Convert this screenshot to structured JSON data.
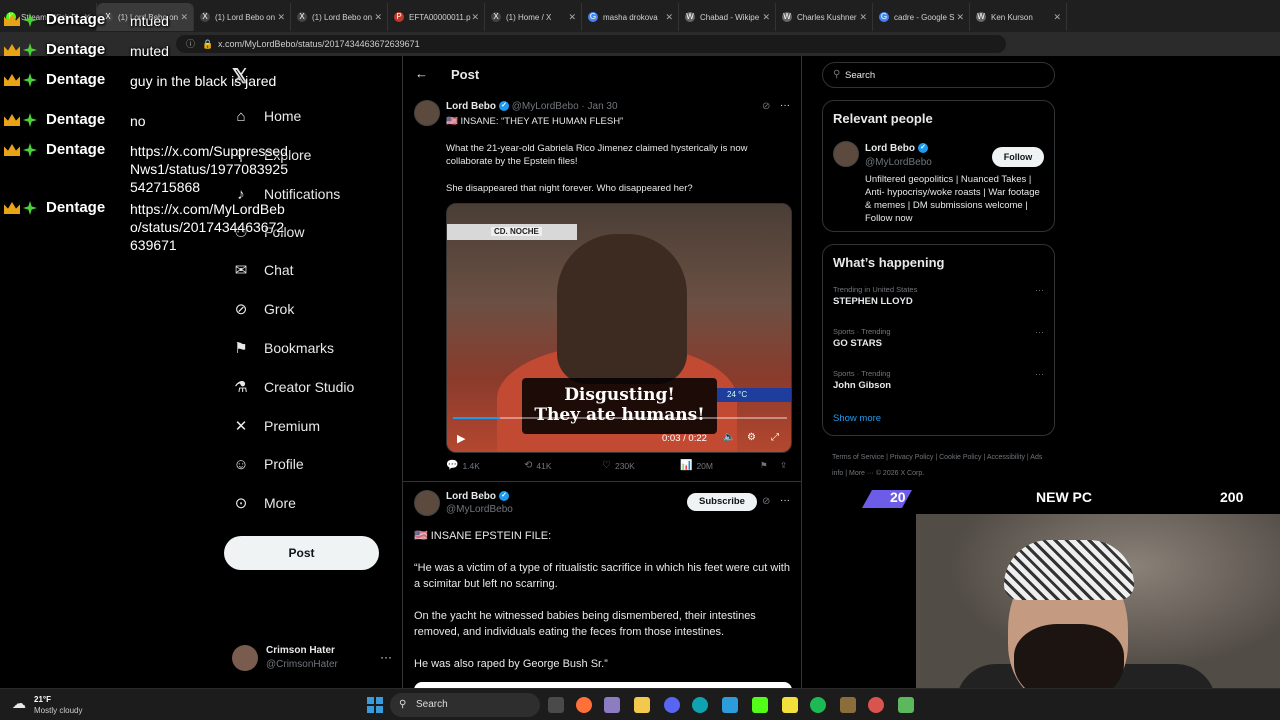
{
  "browser": {
    "tabs": [
      {
        "title": "Stream - Kick D",
        "fav": "K",
        "color": "#53fc18"
      },
      {
        "title": "(1) Lord Bebo on",
        "fav": "X",
        "color": "#444",
        "active": true
      },
      {
        "title": "(1) Lord Bebo on",
        "fav": "X",
        "color": "#444"
      },
      {
        "title": "(1) Lord Bebo on",
        "fav": "X",
        "color": "#444"
      },
      {
        "title": "EFTA00000011.p",
        "fav": "P",
        "color": "#c0392b"
      },
      {
        "title": "(1) Home / X",
        "fav": "X",
        "color": "#444"
      },
      {
        "title": "masha drokova",
        "fav": "G",
        "color": "#4285f4"
      },
      {
        "title": "Chabad - Wikipe",
        "fav": "W",
        "color": "#666"
      },
      {
        "title": "Charles Kushner",
        "fav": "W",
        "color": "#666"
      },
      {
        "title": "cadre - Google S",
        "fav": "G",
        "color": "#4285f4"
      },
      {
        "title": "Ken Kurson",
        "fav": "W",
        "color": "#666"
      }
    ],
    "url": "x.com/MyLordBebo/status/2017434463672639671"
  },
  "nav": {
    "items": [
      {
        "label": "Home",
        "icon": "home-icon",
        "glyph": "⌂"
      },
      {
        "label": "Explore",
        "icon": "search-icon",
        "glyph": "⚲"
      },
      {
        "label": "Notifications",
        "icon": "bell-icon",
        "glyph": "♪"
      },
      {
        "label": "Follow",
        "icon": "follow-icon",
        "glyph": "⚇"
      },
      {
        "label": "Chat",
        "icon": "mail-icon",
        "glyph": "✉"
      },
      {
        "label": "Grok",
        "icon": "grok-icon",
        "glyph": "⊘"
      },
      {
        "label": "Bookmarks",
        "icon": "bookmark-icon",
        "glyph": "⚑"
      },
      {
        "label": "Creator Studio",
        "icon": "flask-icon",
        "glyph": "⚗"
      },
      {
        "label": "Premium",
        "icon": "x-icon",
        "glyph": "✕"
      },
      {
        "label": "Profile",
        "icon": "person-icon",
        "glyph": "☺"
      },
      {
        "label": "More",
        "icon": "more-icon",
        "glyph": "⊙"
      }
    ],
    "post_button": "Post",
    "account": {
      "name": "Crimson Hater",
      "handle": "@CrimsonHater"
    }
  },
  "main": {
    "title": "Post",
    "tweet1": {
      "name": "Lord Bebo",
      "handle": "@MyLordBebo",
      "date": "· Jan 30",
      "headline": "🇺🇸 INSANE: “THEY ATE HUMAN FLESH”",
      "body1": "What the 21-year-old Gabriela Rico Jimenez claimed hysterically is now collaborate by the Epstein files!",
      "body2": "She disappeared that night forever. Who disappeared her?",
      "video": {
        "banner": "CD. NOCHE",
        "caption_line1": "Disgusting!",
        "caption_line2": "They ate humans!",
        "temp": "24 °C",
        "time": "0:03 / 0:22",
        "progress": 0.14
      },
      "stats": {
        "replies": "1.4K",
        "reposts": "41K",
        "likes": "230K",
        "views": "20M"
      }
    },
    "tweet2": {
      "name": "Lord Bebo",
      "handle": "@MyLordBebo",
      "subscribe": "Subscribe",
      "headline": "🇺🇸 INSANE EPSTEIN FILE:",
      "p1": "“He was a victim of a type of ritualistic sacrifice in which his feet were cut with a scimitar but left no scarring.",
      "p2": "On the yacht he witnessed babies being dismembered, their intestines removed, and individuals eating the feces from those intestines.",
      "p3": "He was also raped by George Bush Sr.”"
    }
  },
  "right": {
    "search_placeholder": "Search",
    "relevant": {
      "title": "Relevant people",
      "name": "Lord Bebo",
      "handle": "@MyLordBebo",
      "follow": "Follow",
      "bio": "Unfiltered geopolitics | Nuanced Takes | Anti- hypocrisy/woke roasts | War footage & memes | DM submissions welcome | Follow now"
    },
    "happening": {
      "title": "What’s happening",
      "trends": [
        {
          "meta": "Trending in United States",
          "name": "STEPHEN LLOYD"
        },
        {
          "meta": "Sports · Trending",
          "name": "GO STARS"
        },
        {
          "meta": "Sports · Trending",
          "name": "John Gibson"
        }
      ],
      "show_more": "Show more"
    },
    "footer": "Terms of Service  |  Privacy Policy  |  Cookie Policy  |  Accessibility  |  Ads info  |  More ···  © 2026 X Corp."
  },
  "overlay": {
    "chat": [
      {
        "user": "Dentage",
        "msg": "mtued"
      },
      {
        "user": "Dentage",
        "msg": "muted"
      },
      {
        "user": "Dentage",
        "msg": "guy in the black is jared"
      },
      {
        "user": "Dentage",
        "msg": "no"
      },
      {
        "user": "Dentage",
        "msg": "https://x.com/SuppressedNws1/status/1977083925542715868"
      },
      {
        "user": "Dentage",
        "msg": "https://x.com/MyLordBebo/status/2017434463672639671"
      }
    ],
    "goal": {
      "current": "20",
      "title": "NEW PC",
      "target": "200"
    }
  },
  "taskbar": {
    "temp": "21°F",
    "weather": "Mostly cloudy",
    "search": "Search"
  }
}
